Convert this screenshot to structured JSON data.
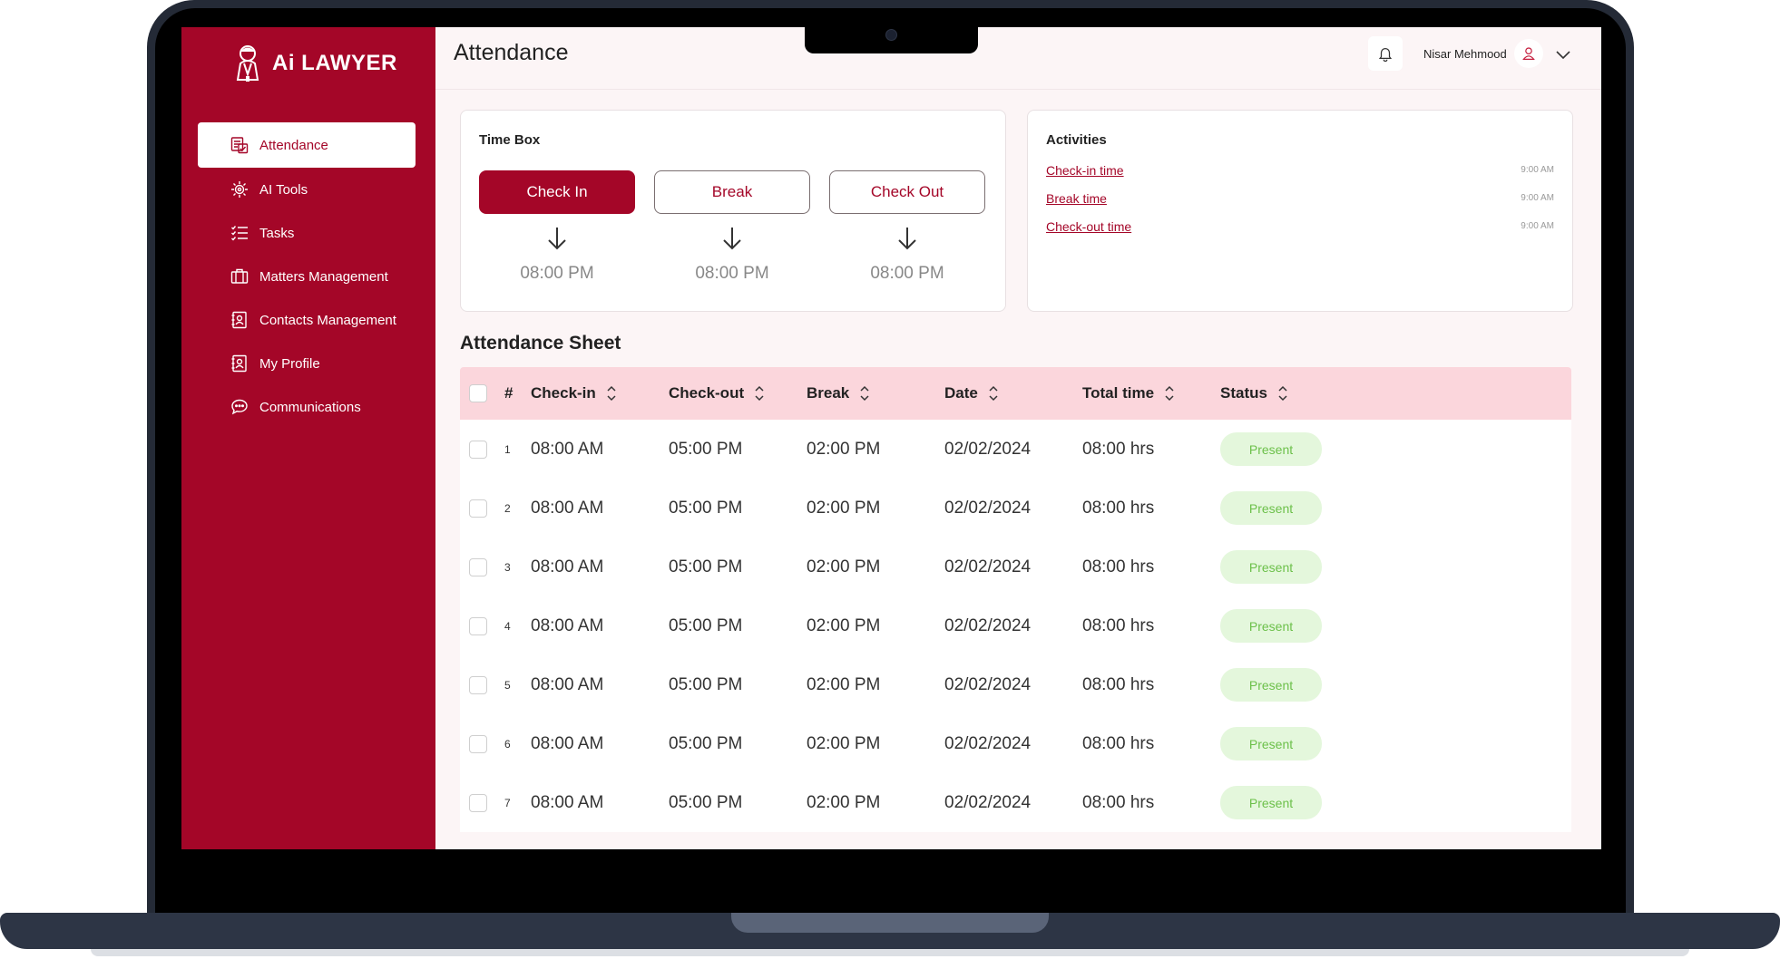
{
  "brand": {
    "name": "Ai LAWYER"
  },
  "sidebar": {
    "items": [
      {
        "label": "Attendance",
        "icon": "attendance-icon",
        "active": true
      },
      {
        "label": "AI Tools",
        "icon": "ai-chip-icon",
        "active": false
      },
      {
        "label": "Tasks",
        "icon": "checklist-icon",
        "active": false
      },
      {
        "label": "Matters Management",
        "icon": "briefcase-icon",
        "active": false
      },
      {
        "label": "Contacts Management",
        "icon": "contact-card-icon",
        "active": false
      },
      {
        "label": "My Profile",
        "icon": "profile-card-icon",
        "active": false
      },
      {
        "label": "Communications",
        "icon": "chat-bubble-icon",
        "active": false
      }
    ]
  },
  "header": {
    "title": "Attendance",
    "user_name": "Nisar Mehmood"
  },
  "timebox": {
    "title": "Time Box",
    "columns": [
      {
        "label": "Check In",
        "time": "08:00 PM"
      },
      {
        "label": "Break",
        "time": "08:00 PM"
      },
      {
        "label": "Check Out",
        "time": "08:00 PM"
      }
    ]
  },
  "activities": {
    "title": "Activities",
    "items": [
      {
        "label": "Check-in time",
        "time": "9:00 AM"
      },
      {
        "label": "Break time",
        "time": "9:00 AM"
      },
      {
        "label": "Check-out time",
        "time": "9:00 AM"
      }
    ]
  },
  "sheet": {
    "title": "Attendance Sheet",
    "columns": [
      "#",
      "Check-in",
      "Check-out",
      "Break",
      "Date",
      "Total time",
      "Status"
    ],
    "rows": [
      {
        "n": "1",
        "checkin": "08:00 AM",
        "checkout": "05:00 PM",
        "break": "02:00 PM",
        "date": "02/02/2024",
        "total": "08:00 hrs",
        "status": "Present"
      },
      {
        "n": "2",
        "checkin": "08:00 AM",
        "checkout": "05:00 PM",
        "break": "02:00 PM",
        "date": "02/02/2024",
        "total": "08:00 hrs",
        "status": "Present"
      },
      {
        "n": "3",
        "checkin": "08:00 AM",
        "checkout": "05:00 PM",
        "break": "02:00 PM",
        "date": "02/02/2024",
        "total": "08:00 hrs",
        "status": "Present"
      },
      {
        "n": "4",
        "checkin": "08:00 AM",
        "checkout": "05:00 PM",
        "break": "02:00 PM",
        "date": "02/02/2024",
        "total": "08:00 hrs",
        "status": "Present"
      },
      {
        "n": "5",
        "checkin": "08:00 AM",
        "checkout": "05:00 PM",
        "break": "02:00 PM",
        "date": "02/02/2024",
        "total": "08:00 hrs",
        "status": "Present"
      },
      {
        "n": "6",
        "checkin": "08:00 AM",
        "checkout": "05:00 PM",
        "break": "02:00 PM",
        "date": "02/02/2024",
        "total": "08:00 hrs",
        "status": "Present"
      },
      {
        "n": "7",
        "checkin": "08:00 AM",
        "checkout": "05:00 PM",
        "break": "02:00 PM",
        "date": "02/02/2024",
        "total": "08:00 hrs",
        "status": "Present"
      }
    ]
  },
  "colors": {
    "brand": "#a40628",
    "header_row": "#fbd6dc",
    "status_bg": "#e4f7dc",
    "status_text": "#6cc04a"
  }
}
